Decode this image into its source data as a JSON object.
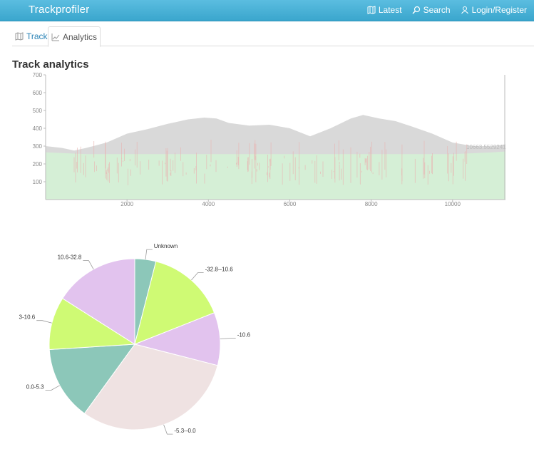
{
  "app": {
    "brand": "Trackprofiler"
  },
  "nav": {
    "items": [
      {
        "label": "Latest",
        "icon": "map-icon"
      },
      {
        "label": "Search",
        "icon": "search-icon"
      },
      {
        "label": "Login/Register",
        "icon": "user-icon"
      }
    ]
  },
  "tabs": [
    {
      "label": "Track",
      "icon": "map-icon",
      "active": false
    },
    {
      "label": "Analytics",
      "icon": "chart-icon",
      "active": true
    }
  ],
  "page": {
    "title": "Track analytics"
  },
  "colors": {
    "navbar": "#3aa6cd",
    "elevation_fill": "#d9d9d9",
    "speed_fill": "#d5efd6",
    "spike_line": "#e9b7b4",
    "pie_teal": "#8cc7b9",
    "pie_lime": "#cffa74",
    "pie_lilac": "#e2c3ee",
    "pie_blush": "#efe2e2"
  },
  "chart_data": [
    {
      "type": "area",
      "title": "",
      "xlabel": "",
      "ylabel": "",
      "xlim": [
        0,
        11300
      ],
      "ylim": [
        0,
        700
      ],
      "x_ticks": [
        2000,
        4000,
        6000,
        8000,
        10000
      ],
      "y_ticks": [
        100,
        200,
        300,
        400,
        500,
        600,
        700
      ],
      "annotation": "10663.5529241",
      "series": [
        {
          "x": [
            0,
            400,
            700,
            1000,
            1500,
            2000,
            2500,
            3000,
            3500,
            3900,
            4200,
            4500,
            5000,
            5500,
            6000,
            6500,
            7000,
            7500,
            7800,
            8200,
            8600,
            9000,
            9500,
            10000,
            10500,
            11000,
            11300
          ],
          "values": [
            300,
            290,
            275,
            290,
            320,
            370,
            395,
            425,
            450,
            460,
            455,
            430,
            415,
            420,
            400,
            355,
            400,
            455,
            475,
            455,
            440,
            410,
            370,
            320,
            300,
            300,
            310
          ]
        },
        {
          "x": [
            0,
            500,
            1000,
            1500,
            2000,
            2500,
            3000,
            3500,
            4000,
            4500,
            5000,
            5500,
            6000,
            6500,
            7000,
            7500,
            8000,
            8500,
            9000,
            9500,
            10000,
            10500,
            11000,
            11300
          ],
          "values": [
            265,
            260,
            255,
            255,
            255,
            255,
            255,
            255,
            255,
            255,
            255,
            255,
            255,
            255,
            255,
            255,
            255,
            255,
            255,
            255,
            255,
            260,
            265,
            270
          ]
        }
      ]
    },
    {
      "type": "pie",
      "title": "",
      "categories": [
        "Unknown",
        "-32.8--10.6",
        "-10.6",
        "-5.3--0.0",
        "0.0-5.3",
        "3-10.6",
        "10.6-32.8"
      ],
      "values": [
        4,
        15,
        10,
        31,
        14,
        10,
        16
      ]
    }
  ]
}
